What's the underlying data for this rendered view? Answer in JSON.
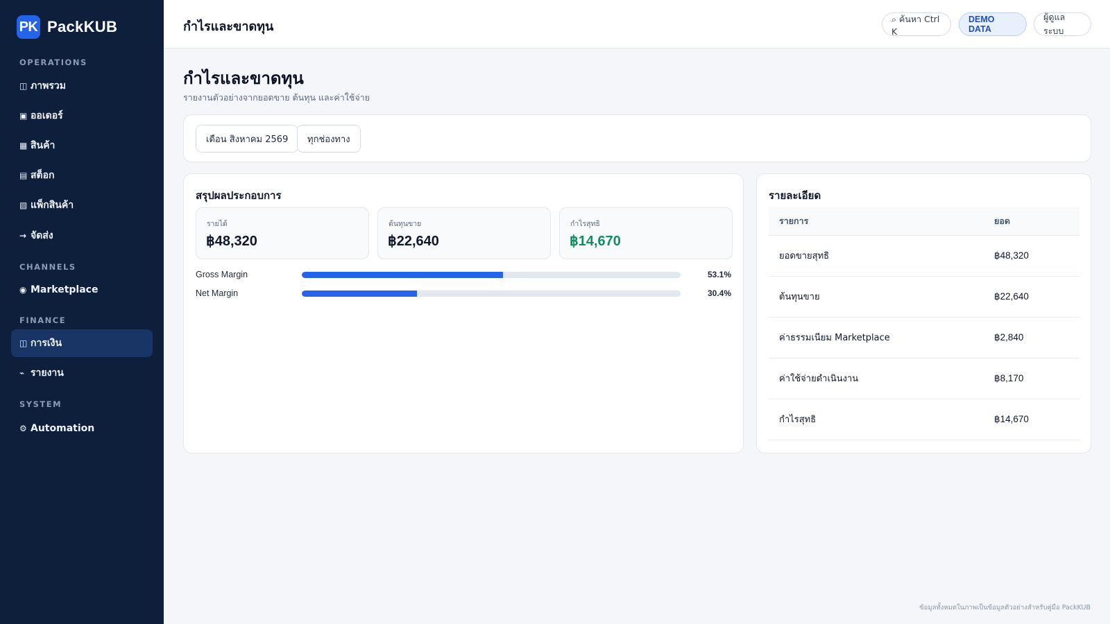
{
  "brand": {
    "mark": "PK",
    "name": "PackKUB"
  },
  "sidebar": {
    "sections": [
      {
        "title": "OPERATIONS"
      },
      {
        "title": "CHANNELS"
      },
      {
        "title": "FINANCE"
      },
      {
        "title": "SYSTEM"
      }
    ],
    "items": [
      {
        "icon": "◫",
        "label": "ภาพรวม"
      },
      {
        "icon": "▣",
        "label": "ออเดอร์"
      },
      {
        "icon": "▦",
        "label": "สินค้า"
      },
      {
        "icon": "▤",
        "label": "สต็อก"
      },
      {
        "icon": "▧",
        "label": "แพ็กสินค้า"
      },
      {
        "icon": "→",
        "label": "จัดส่ง"
      },
      {
        "icon": "◉",
        "label": "Marketplace"
      },
      {
        "icon": "◫",
        "label": "การเงิน"
      },
      {
        "icon": "⌁",
        "label": "รายงาน"
      },
      {
        "icon": "⚙",
        "label": "Automation"
      }
    ]
  },
  "topbar": {
    "title": "กำไรและขาดทุน",
    "search_label": "⌕ ค้นหา Ctrl K",
    "demo_label": "DEMO DATA",
    "admin_label": "ผู้ดูแลระบบ"
  },
  "page": {
    "title": "กำไรและขาดทุน",
    "subtitle": "รายงานตัวอย่างจากยอดขาย ต้นทุน และค่าใช้จ่าย"
  },
  "filters": {
    "month": "เดือน สิงหาคม 2569",
    "channel": "ทุกช่องทาง"
  },
  "summary": {
    "title": "สรุปผลประกอบการ",
    "kpis": [
      {
        "label": "รายได้",
        "value": "฿48,320"
      },
      {
        "label": "ต้นทุนขาย",
        "value": "฿22,640"
      },
      {
        "label": "กำไรสุทธิ",
        "value": "฿14,670"
      }
    ],
    "margins": [
      {
        "label": "Gross Margin",
        "percent": 53.1,
        "display": "53.1%"
      },
      {
        "label": "Net Margin",
        "percent": 30.4,
        "display": "30.4%"
      }
    ]
  },
  "detail": {
    "title": "รายละเอียด",
    "columns": [
      "รายการ",
      "ยอด"
    ],
    "rows": [
      [
        "ยอดขายสุทธิ",
        "฿48,320"
      ],
      [
        "ต้นทุนขาย",
        "฿22,640"
      ],
      [
        "ค่าธรรมเนียม Marketplace",
        "฿2,840"
      ],
      [
        "ค่าใช้จ่ายดำเนินงาน",
        "฿8,170"
      ],
      [
        "กำไรสุทธิ",
        "฿14,670"
      ]
    ]
  },
  "footer": {
    "note": "ข้อมูลทั้งหมดในภาพเป็นข้อมูลตัวอย่างสำหรับคู่มือ PackKUB"
  },
  "colors": {
    "accent": "#2563eb",
    "sidebar": "#0e1f3c",
    "active_item": "#183565",
    "profit": "#0e8f5e"
  }
}
